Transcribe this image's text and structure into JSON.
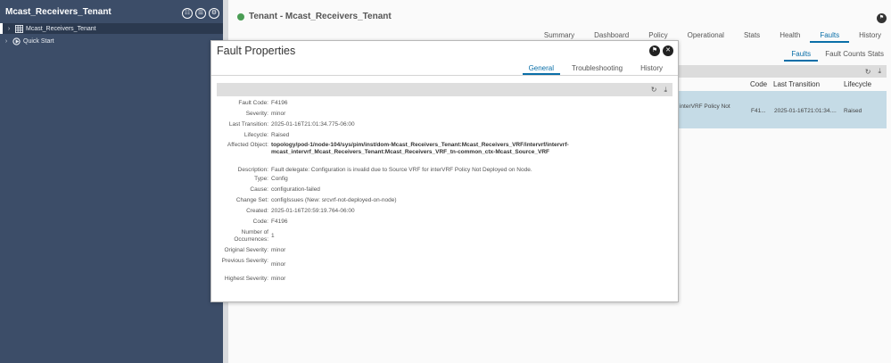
{
  "sidebar": {
    "title": "Mcast_Receivers_Tenant",
    "header_icons": [
      "filter-icon",
      "list-icon",
      "settings-icon"
    ],
    "tree": [
      {
        "label": "Mcast_Receivers_Tenant",
        "icon": "tenant-grid-icon",
        "selected": true
      },
      {
        "label": "Quick Start",
        "icon": "quick-start-icon",
        "selected": false
      }
    ]
  },
  "main": {
    "tenant_title": "Tenant - Mcast_Receivers_Tenant",
    "tabs": [
      "Summary",
      "Dashboard",
      "Policy",
      "Operational",
      "Stats",
      "Health",
      "Faults",
      "History"
    ],
    "active_tab": "Faults",
    "subtabs": [
      "Faults",
      "Fault Counts Stats"
    ],
    "active_subtab": "Faults",
    "table": {
      "headers": {
        "code": "Code",
        "last_transition": "Last Transition",
        "lifecycle": "Lifecycle"
      },
      "row": {
        "description": "r interVRF Policy Not",
        "code": "F41...",
        "last_transition": "2025-01-16T21:01:34....",
        "lifecycle": "Raised"
      }
    }
  },
  "modal": {
    "title": "Fault Properties",
    "tabs": [
      "General",
      "Troubleshooting",
      "History"
    ],
    "active_tab": "General",
    "properties": [
      {
        "key": "Fault Code:",
        "value": "F4196"
      },
      {
        "key": "Severity:",
        "value": "minor"
      },
      {
        "key": "Last Transition:",
        "value": "2025-01-16T21:01:34.775-06:00"
      },
      {
        "key": "Lifecycle:",
        "value": "Raised"
      },
      {
        "key": "Affected Object:",
        "value": "topology/pod-1/node-104/sys/pim/inst/dom-Mcast_Receivers_Tenant:Mcast_Receivers_VRF/intervrf/intervrf-mcast_intervrf_Mcast_Receivers_Tenant:Mcast_Receivers_VRF_tn-common_ctx-Mcast_Source_VRF",
        "bold": true
      },
      {
        "key": "Description:",
        "value": "Fault delegate: Configuration is invalid due to Source VRF for interVRF Policy Not Deployed on Node."
      },
      {
        "key": "Type:",
        "value": "Config"
      },
      {
        "key": "Cause:",
        "value": "configuration-failed"
      },
      {
        "key": "Change Set:",
        "value": "configIssues (New: srcvrf-not-deployed-on-node)"
      },
      {
        "key": "Created:",
        "value": "2025-01-16T20:59:19.764-06:00"
      },
      {
        "key": "Code:",
        "value": "F4196"
      },
      {
        "key": "Number of Occurrences:",
        "value": "1"
      },
      {
        "key": "Original Severity:",
        "value": "minor"
      },
      {
        "key": "Previous Severity:",
        "value": "minor"
      },
      {
        "key": "Highest Severity:",
        "value": "minor"
      }
    ]
  }
}
